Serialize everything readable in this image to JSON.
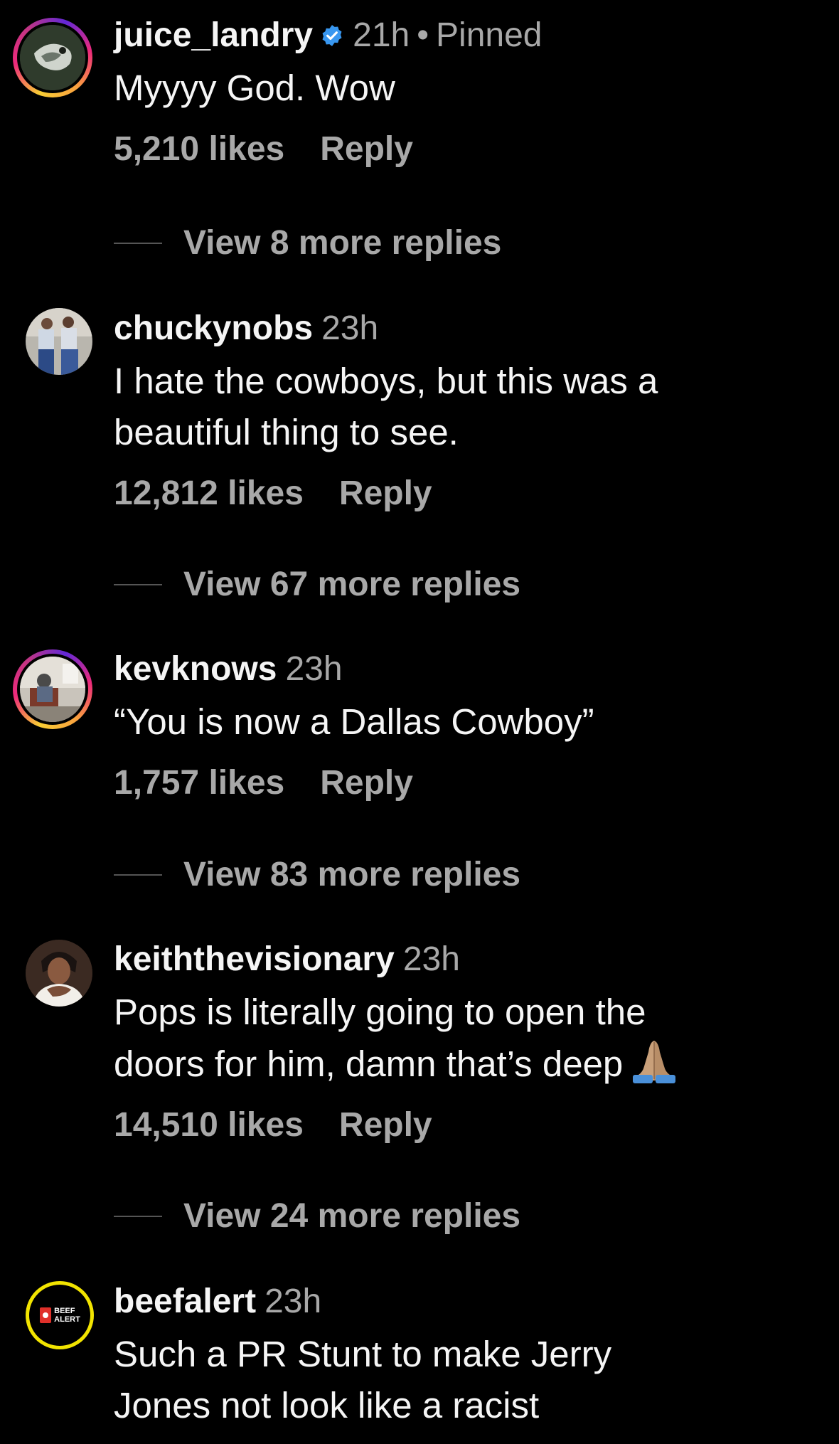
{
  "comments": [
    {
      "username": "juice_landry",
      "verified": true,
      "time": "21h",
      "pinned": "Pinned",
      "text_lines": [
        "Myyyy God. Wow"
      ],
      "likes": "5,210 likes",
      "reply": "Reply",
      "view_more": "View 8 more replies"
    },
    {
      "username": "chuckynobs",
      "time": "23h",
      "text_lines": [
        "I hate the cowboys, but this was a",
        "beautiful thing to see."
      ],
      "likes": "12,812 likes",
      "reply": "Reply",
      "view_more": "View 67 more replies"
    },
    {
      "username": "kevknows",
      "time": "23h",
      "text_lines": [
        "“You is now a Dallas Cowboy”"
      ],
      "likes": "1,757 likes",
      "reply": "Reply",
      "view_more": "View 83 more replies"
    },
    {
      "username": "keiththevisionary",
      "time": "23h",
      "text_lines": [
        "Pops is literally going to open the",
        "doors for him, damn that’s deep"
      ],
      "emoji": "folded-hands-emoji",
      "likes": "14,510 likes",
      "reply": "Reply",
      "view_more": "View 24 more replies"
    },
    {
      "username": "beefalert",
      "time": "23h",
      "avatar_text": [
        "BEEF",
        "ALERT"
      ],
      "text_lines": [
        "Such a PR Stunt to make Jerry",
        "Jones not look like a racist"
      ]
    }
  ],
  "colors": {
    "background": "#000000",
    "primary_text": "#f5f5f5",
    "secondary_text": "#a8a8a8",
    "verified_blue": "#3897f0"
  }
}
